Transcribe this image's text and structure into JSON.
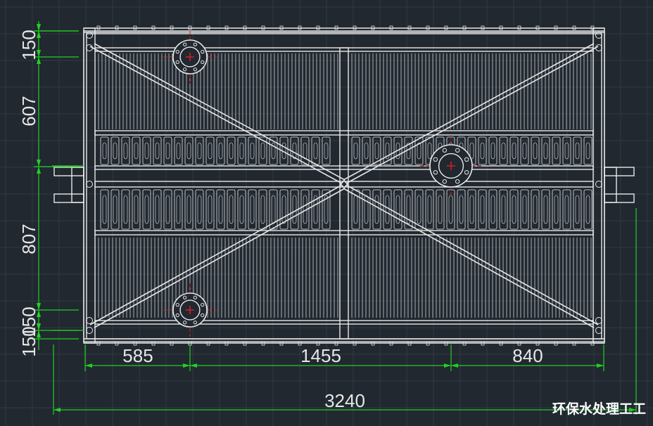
{
  "drawing": {
    "background_color": "#212830",
    "grid_color": "#2f3a45",
    "line_color": "#e8e8e8",
    "dimension_color": "#22d022",
    "center_mark_color": "#e02020",
    "dimensions": {
      "left": [
        "150",
        "607",
        "807",
        "150",
        "150"
      ],
      "bottom": [
        "585",
        "1455",
        "840"
      ],
      "overall": "3240"
    },
    "watermark": "环保水处理工工"
  }
}
